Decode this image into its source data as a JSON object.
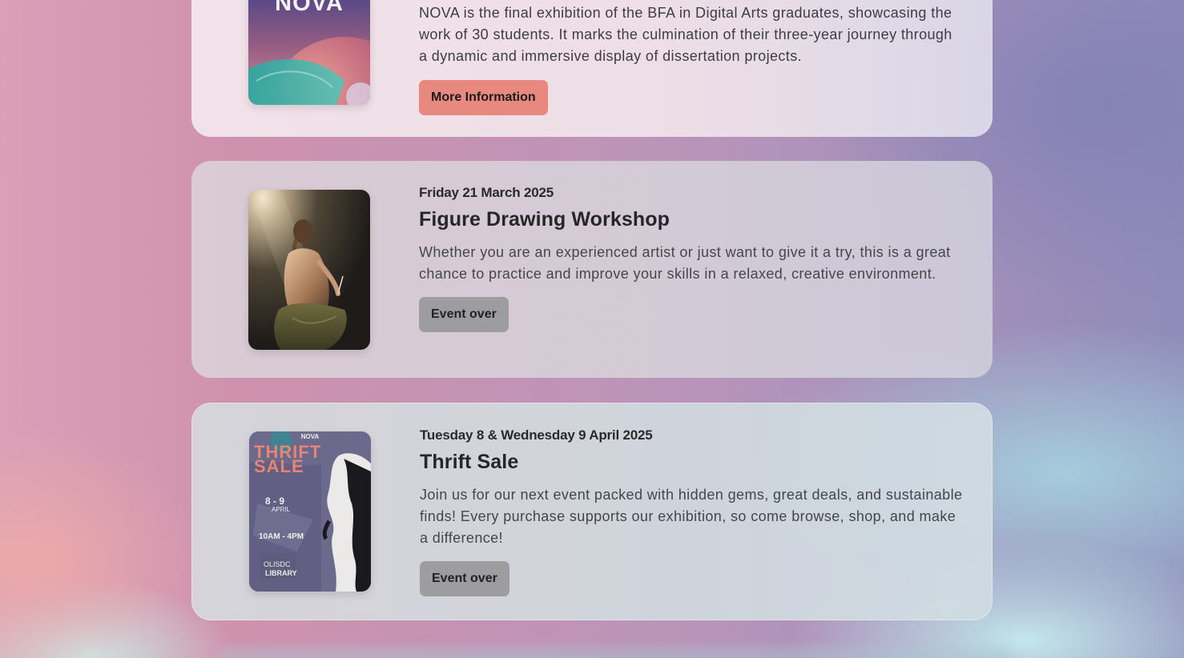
{
  "events": [
    {
      "image": {
        "kind": "nova-poster",
        "logo_text": "NOVA",
        "colors": [
          "#3b4a86",
          "#7a4f7a",
          "#c98b86",
          "#35a7a0"
        ]
      },
      "description": "NOVA is the final exhibition of the BFA in Digital Arts graduates, showcasing the work of 30 students. It marks the culmination of their three-year journey through a dynamic and immersive display of dissertation projects.",
      "button_label": "More Information",
      "button_color": "#e8897f"
    },
    {
      "date": "Friday 21 March 2025",
      "title": "Figure Drawing Workshop",
      "image": {
        "kind": "figure-photo"
      },
      "description": "Whether you are an experienced artist or just want to give it a try, this is a great chance to practice and improve your skills in a relaxed, creative environment.",
      "button_label": "Event over",
      "button_color": "#9d9d9f"
    },
    {
      "date": "Tuesday 8 & Wednesday 9 April 2025",
      "title": "Thrift Sale",
      "image": {
        "kind": "thrift-poster",
        "header_text": "NOVA",
        "title_line1": "THRIFT",
        "title_line2": "SALE",
        "dates": "8 - 9",
        "month": "APRIL",
        "hours": "10AM - 4PM",
        "venue_line1": "OLISDC",
        "venue_line2": "LIBRARY"
      },
      "description": "Join us for our next event packed with hidden gems, great deals, and sustainable finds! Every purchase supports our exhibition, so come browse, shop, and make a difference!",
      "button_label": "Event over",
      "button_color": "#9d9d9f"
    }
  ]
}
